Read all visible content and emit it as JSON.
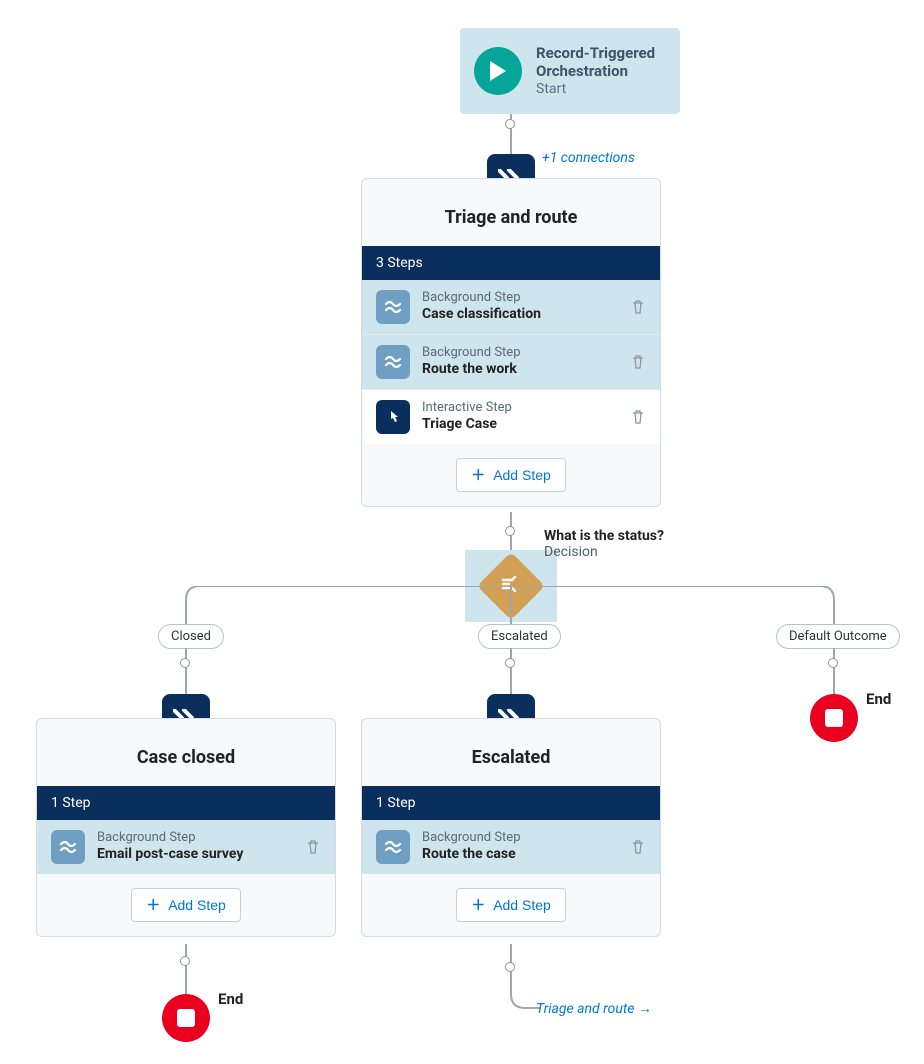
{
  "start": {
    "title": "Record-Triggered Orchestration",
    "subtitle": "Start"
  },
  "connections_link": "+1 connections",
  "stages": {
    "triage": {
      "title": "Triage and route",
      "steps_count": "3 Steps",
      "steps": [
        {
          "kind": "Background Step",
          "name": "Case classification",
          "type": "bg",
          "highlight": true
        },
        {
          "kind": "Background Step",
          "name": "Route the work",
          "type": "bg",
          "highlight": true
        },
        {
          "kind": "Interactive Step",
          "name": "Triage Case",
          "type": "int",
          "highlight": false
        }
      ],
      "add_step": "Add Step"
    },
    "closed": {
      "title": "Case closed",
      "steps_count": "1 Step",
      "steps": [
        {
          "kind": "Background Step",
          "name": "Email post-case survey",
          "type": "bg",
          "highlight": true
        }
      ],
      "add_step": "Add Step"
    },
    "escalated": {
      "title": "Escalated",
      "steps_count": "1 Step",
      "steps": [
        {
          "kind": "Background Step",
          "name": "Route the case",
          "type": "bg",
          "highlight": true
        }
      ],
      "add_step": "Add Step"
    }
  },
  "decision": {
    "question": "What is the status?",
    "type": "Decision",
    "outcomes": {
      "closed": "Closed",
      "escalated": "Escalated",
      "default": "Default Outcome"
    }
  },
  "end": {
    "label_left": "End",
    "label_right": "End"
  },
  "loop_back": "Triage and route →"
}
